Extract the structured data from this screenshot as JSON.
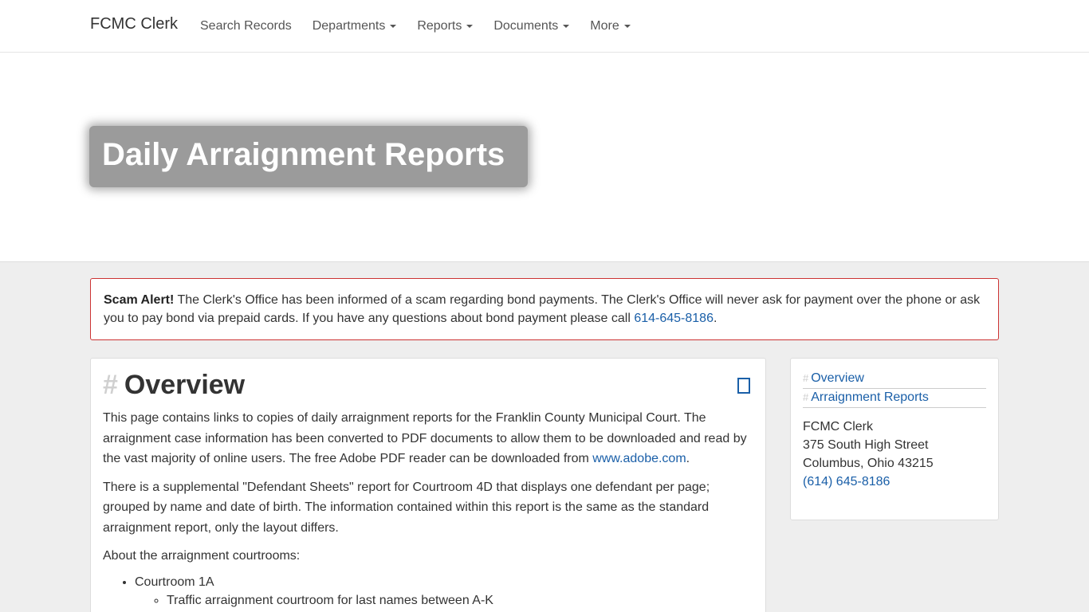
{
  "navbar": {
    "brand": "FCMC Clerk",
    "items": [
      {
        "label": "Search Records",
        "dropdown": false
      },
      {
        "label": "Departments",
        "dropdown": true
      },
      {
        "label": "Reports",
        "dropdown": true
      },
      {
        "label": "Documents",
        "dropdown": true
      },
      {
        "label": "More",
        "dropdown": true
      }
    ]
  },
  "hero": {
    "title": "Daily Arraignment Reports"
  },
  "alert": {
    "label": "Scam Alert!",
    "text": " The Clerk's Office has been informed of a scam regarding bond payments. The Clerk's Office will never ask for payment over the phone or ask you to pay bond via prepaid cards. If you have any questions about bond payment please call ",
    "phone": "614-645-8186",
    "trailing": "."
  },
  "overview": {
    "hash": "#",
    "heading": "Overview",
    "p1": "This page contains links to copies of daily arraignment reports for the Franklin County Municipal Court. The arraignment case information has been converted to PDF documents to allow them to be downloaded and read by the vast majority of online users. The free Adobe PDF reader can be downloaded from ",
    "p1_link": "www.adobe.com",
    "p1_end": ".",
    "p2": "There is a supplemental \"Defendant Sheets\" report for Courtroom 4D that displays one defendant per page; grouped by name and date of birth. The information contained within this report is the same as the standard arraignment report, only the layout differs.",
    "p3": "About the arraignment courtrooms:",
    "courtrooms": [
      {
        "name": "Courtroom 1A",
        "details": [
          "Traffic arraignment courtroom for last names between A-K"
        ]
      }
    ]
  },
  "sidebar": {
    "toc": [
      {
        "hash": "#",
        "label": "Overview"
      },
      {
        "hash": "#",
        "label": "Arraignment Reports"
      }
    ],
    "address": {
      "name": "FCMC Clerk",
      "street": "375 South High Street",
      "city": "Columbus, Ohio 43215",
      "phone": "(614) 645-8186"
    }
  }
}
